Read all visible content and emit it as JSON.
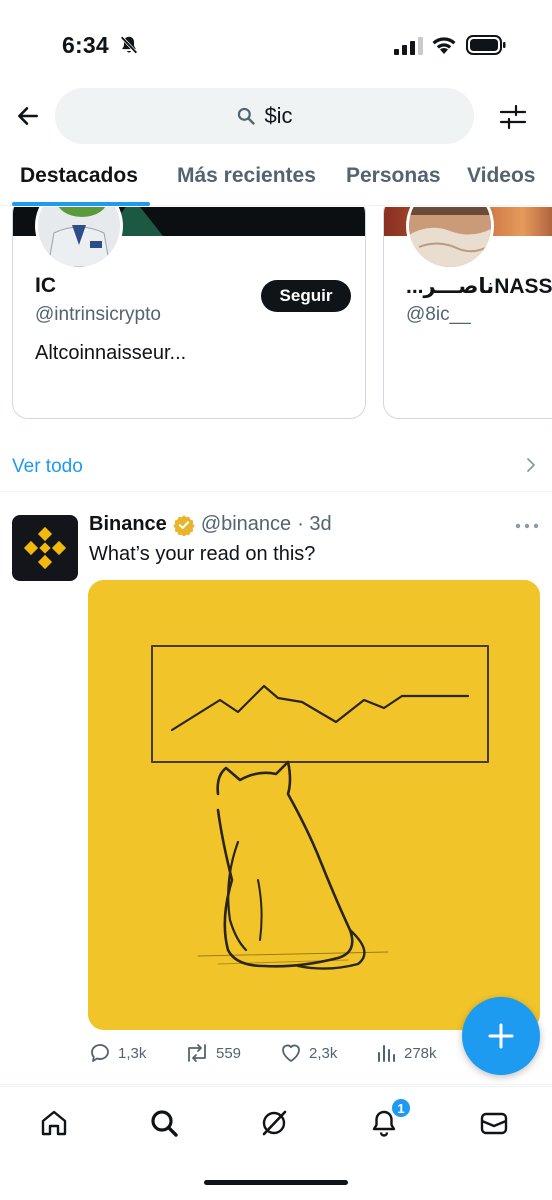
{
  "status_bar": {
    "time": "6:34"
  },
  "search": {
    "query": "$ic"
  },
  "tabs": [
    {
      "label": "Destacados",
      "active": true
    },
    {
      "label": "Más recientes",
      "active": false
    },
    {
      "label": "Personas",
      "active": false
    },
    {
      "label": "Videos",
      "active": false
    }
  ],
  "people": [
    {
      "name": "IC",
      "handle": "@intrinsicrypto",
      "bio": "Altcoinnaisseur...",
      "follow_label": "Seguir"
    },
    {
      "name": "...ناصـــرNASS",
      "handle": "@8ic__"
    }
  ],
  "see_all": "Ver todo",
  "post": {
    "name": "Binance",
    "handle": "@binance",
    "time": "· 3d",
    "text": "What’s your read on this?",
    "media_color": "#f1c52a",
    "replies": "1,3k",
    "reposts": "559",
    "likes": "2,3k",
    "views": "278k"
  },
  "notifications_badge": "1",
  "colors": {
    "accent": "#1d9bf0",
    "text": "#0f1419",
    "muted": "#536471",
    "verified": "#e8b52a",
    "binance": "#f0b90b"
  }
}
